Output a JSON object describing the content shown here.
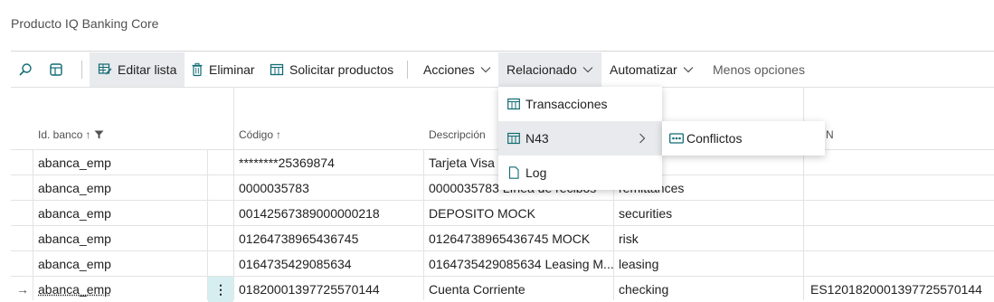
{
  "page": {
    "title": "Producto IQ Banking Core"
  },
  "toolbar": {
    "search_icon": "search-icon",
    "view_icon": "view-layout-icon",
    "edit_list": "Editar lista",
    "delete": "Eliminar",
    "request_products": "Solicitar productos",
    "actions": "Acciones",
    "related": "Relacionado",
    "automate": "Automatizar",
    "fewer_options": "Menos opciones"
  },
  "table": {
    "headers": {
      "bank_id": "Id. banco",
      "code": "Código",
      "description": "Descripción",
      "last": "N"
    },
    "rows": [
      {
        "bank": "abanca_emp",
        "code": "********25369874",
        "description": "Tarjeta Visa",
        "type": "",
        "iban": ""
      },
      {
        "bank": "abanca_emp",
        "code": "0000035783",
        "description": "0000035783 Línea de recibos",
        "type": "remittances",
        "iban": ""
      },
      {
        "bank": "abanca_emp",
        "code": "00142567389000000218",
        "description": "DEPOSITO MOCK",
        "type": "securities",
        "iban": ""
      },
      {
        "bank": "abanca_emp",
        "code": "01264738965436745",
        "description": "01264738965436745 MOCK",
        "type": "risk",
        "iban": ""
      },
      {
        "bank": "abanca_emp",
        "code": "0164735429085634",
        "description": "0164735429085634 Leasing M...",
        "type": "leasing",
        "iban": ""
      },
      {
        "bank": "abanca_emp",
        "code": "01820001397725570144",
        "description": "Cuenta Corriente",
        "type": "checking",
        "iban": "ES1201820001397725570144"
      }
    ]
  },
  "related_menu": {
    "items": [
      {
        "label": "Transacciones",
        "icon": "table-icon"
      },
      {
        "label": "N43",
        "icon": "table-icon"
      },
      {
        "label": "Log",
        "icon": "document-icon"
      }
    ]
  },
  "submenu": {
    "items": [
      {
        "label": "Conflictos",
        "icon": "conflicts-icon"
      }
    ]
  },
  "colors": {
    "accent": "#0f6b73",
    "selection": "#d7eef0",
    "menu_highlight": "#e8eaed"
  }
}
